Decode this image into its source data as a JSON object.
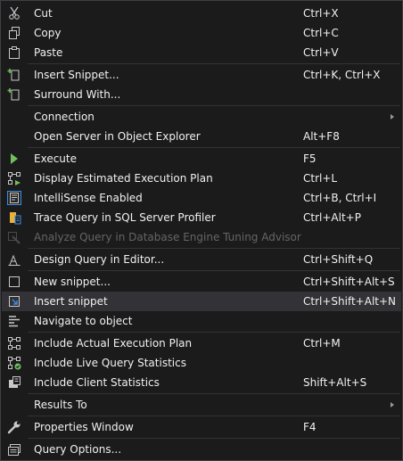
{
  "menu": {
    "cut": {
      "label": "Cut",
      "shortcut": "Ctrl+X",
      "icon": "scissors-icon"
    },
    "copy": {
      "label": "Copy",
      "shortcut": "Ctrl+C",
      "icon": "copy-icon"
    },
    "paste": {
      "label": "Paste",
      "shortcut": "Ctrl+V",
      "icon": "paste-icon"
    },
    "insert_snippet_ellipsis": {
      "label": "Insert Snippet...",
      "shortcut": "Ctrl+K, Ctrl+X",
      "icon": "snippet-icon"
    },
    "surround_with": {
      "label": "Surround With...",
      "icon": "surround-icon"
    },
    "connection": {
      "label": "Connection",
      "has_submenu": true
    },
    "open_server": {
      "label": "Open Server in Object Explorer",
      "shortcut": "Alt+F8"
    },
    "execute": {
      "label": "Execute",
      "shortcut": "F5",
      "icon": "play-icon"
    },
    "display_plan": {
      "label": "Display Estimated Execution Plan",
      "shortcut": "Ctrl+L",
      "icon": "execution-plan-icon"
    },
    "intellisense": {
      "label": "IntelliSense Enabled",
      "shortcut": "Ctrl+B, Ctrl+I",
      "icon": "intellisense-icon",
      "checked": true
    },
    "trace_query": {
      "label": "Trace Query in SQL Server Profiler",
      "shortcut": "Ctrl+Alt+P",
      "icon": "profiler-icon"
    },
    "analyze_query": {
      "label": "Analyze Query in Database Engine Tuning Advisor",
      "icon": "tuning-advisor-icon",
      "disabled": true
    },
    "design_query": {
      "label": "Design Query in Editor...",
      "shortcut": "Ctrl+Shift+Q",
      "icon": "design-query-icon"
    },
    "new_snippet": {
      "label": "New snippet...",
      "shortcut": "Ctrl+Shift+Alt+S",
      "icon": "new-snippet-icon"
    },
    "insert_snippet": {
      "label": "Insert snippet",
      "shortcut": "Ctrl+Shift+Alt+N",
      "icon": "insert-snippet-icon",
      "selected": true
    },
    "navigate": {
      "label": "Navigate to object",
      "icon": "navigate-icon"
    },
    "actual_plan": {
      "label": "Include Actual Execution Plan",
      "shortcut": "Ctrl+M",
      "icon": "actual-plan-icon"
    },
    "live_stats": {
      "label": "Include Live Query Statistics",
      "icon": "live-stats-icon"
    },
    "client_stats": {
      "label": "Include Client Statistics",
      "shortcut": "Shift+Alt+S",
      "icon": "client-stats-icon"
    },
    "results_to": {
      "label": "Results To",
      "has_submenu": true
    },
    "properties": {
      "label": "Properties Window",
      "shortcut": "F4",
      "icon": "wrench-icon"
    },
    "query_options": {
      "label": "Query Options...",
      "icon": "query-options-icon"
    }
  },
  "colors": {
    "background": "#1b1b1c",
    "selected": "#333337",
    "text": "#f1f1f1",
    "disabled_text": "#656565",
    "accent_green": "#6fbf5c",
    "accent_blue": "#3c8ee3"
  }
}
